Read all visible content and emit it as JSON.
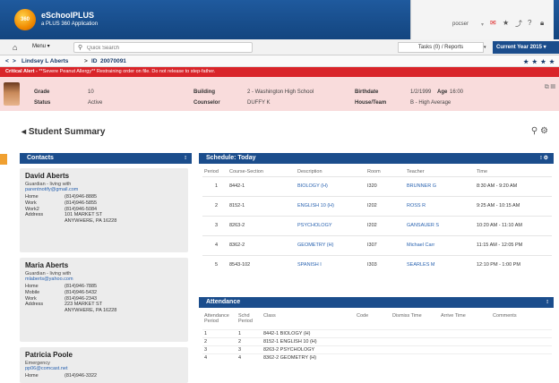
{
  "header": {
    "app_title": "eSchoolPLUS",
    "app_subtitle": "a PLUS 360 Application",
    "logo_text": "360",
    "user": "pocser",
    "icons": [
      "bell-icon",
      "star-icon",
      "share-icon",
      "help-icon",
      "lock-icon"
    ]
  },
  "menubar": {
    "menu_label": "Menu ▾",
    "search_placeholder": "Quick Search",
    "tasks_label": "Tasks (0) / Reports",
    "year_label": "Current Year 2015 ▾"
  },
  "student_nav": {
    "name": "Lindsey L Aberts",
    "id_label": "ID",
    "id_value": "20070091"
  },
  "alert": {
    "prefix": "Critical Alert - ",
    "text": "**Severe Peanut Allergy** Restraining order on file. Do not release to step-father."
  },
  "student_info": {
    "grade_label": "Grade",
    "grade_value": "10",
    "status_label": "Status",
    "status_value": "Active",
    "building_label": "Building",
    "building_value": "2 - Washington High School",
    "counselor_label": "Counselor",
    "counselor_value": "DUFFY K",
    "birthdate_label": "Birthdate",
    "birthdate_value": "1/2/1999",
    "age_label": "Age",
    "age_value": "16:00",
    "house_label": "House/Team",
    "house_value": "B - High Average"
  },
  "summary_title": "Student Summary",
  "contacts": {
    "title": "Contacts",
    "items": [
      {
        "name": "David Aberts",
        "role": "Guardian - living with",
        "email": "parentnotify@gmail.com",
        "rows": [
          [
            "Home",
            "(814)946-8885"
          ],
          [
            "Work",
            "(814)946-5855"
          ],
          [
            "Work2",
            "(814)946-5084"
          ],
          [
            "Address",
            "101 MARKET ST"
          ],
          [
            "",
            "ANYWHERE, PA 16228"
          ]
        ]
      },
      {
        "name": "Maria Aberts",
        "role": "Guardian - living with",
        "email": "mlaberts@yahoo.com",
        "rows": [
          [
            "Home",
            "(814)946-7885"
          ],
          [
            "Mobile",
            "(814)946-5432"
          ],
          [
            "Work",
            "(814)946-2343"
          ],
          [
            "Address",
            "223 MARKET ST"
          ],
          [
            "",
            "ANYWHERE, PA 16228"
          ]
        ]
      },
      {
        "name": "Patricia Poole",
        "role": "Emergency",
        "email": "pp06@comcast.net",
        "rows": [
          [
            "Home",
            "(814)946-3322"
          ]
        ]
      }
    ]
  },
  "schedule": {
    "title": "Schedule: Today",
    "headers": [
      "Period",
      "Course-Section",
      "Description",
      "Room",
      "Teacher",
      "Time"
    ],
    "rows": [
      [
        "1",
        "8442-1",
        "BIOLOGY (H)",
        "I320",
        "BRUNNER G",
        "8:30 AM - 9:20 AM"
      ],
      [
        "2",
        "8152-1",
        "ENGLISH 10 (H)",
        "I202",
        "ROSS R",
        "9:25 AM - 10:15 AM"
      ],
      [
        "3",
        "8263-2",
        "PSYCHOLOGY",
        "I202",
        "GANSAUER S",
        "10:20 AM - 11:10 AM"
      ],
      [
        "4",
        "8362-2",
        "GEOMETRY (H)",
        "I307",
        "Michael Carr",
        "11:15 AM - 12:05 PM"
      ],
      [
        "5",
        "8543-102",
        "SPANISH I",
        "I303",
        "SEARLES M",
        "12:10 PM - 1:00 PM"
      ]
    ]
  },
  "attendance": {
    "title": "Attendance",
    "headers": [
      "Attendance Period",
      "Schd Period",
      "Class",
      "Code",
      "Dismiss Time",
      "Arrive Time",
      "Comments"
    ],
    "rows": [
      [
        "1",
        "1",
        "8442-1 BIOLOGY (H)"
      ],
      [
        "2",
        "2",
        "8152-1 ENGLISH 10 (H)"
      ],
      [
        "3",
        "3",
        "8263-2 PSYCHOLOGY"
      ],
      [
        "4",
        "4",
        "8362-2 GEOMETRY (H)"
      ]
    ]
  }
}
